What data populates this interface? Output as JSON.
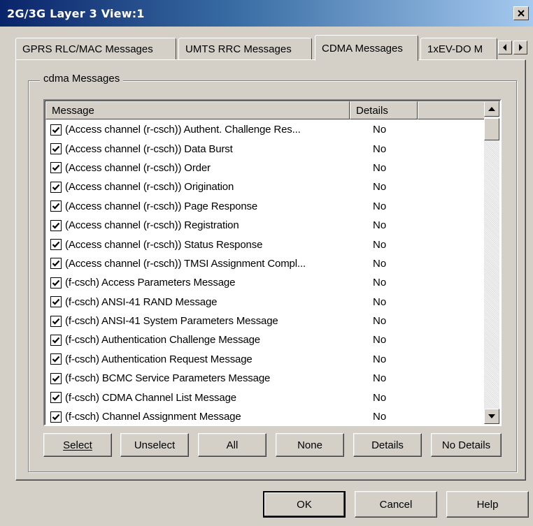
{
  "window": {
    "title": "2G/3G Layer 3 View:1"
  },
  "tabs": [
    {
      "label": "GPRS RLC/MAC Messages",
      "active": false
    },
    {
      "label": "UMTS RRC Messages",
      "active": false
    },
    {
      "label": "CDMA Messages",
      "active": true
    },
    {
      "label": "1xEV-DO M",
      "active": false
    }
  ],
  "group": {
    "title": "cdma Messages"
  },
  "list": {
    "columns": [
      "Message",
      "Details",
      ""
    ],
    "rows": [
      {
        "message": "(Access channel (r-csch)) Authent. Challenge Res...",
        "details": "No",
        "checked": true
      },
      {
        "message": "(Access channel (r-csch)) Data Burst",
        "details": "No",
        "checked": true
      },
      {
        "message": "(Access channel (r-csch)) Order",
        "details": "No",
        "checked": true
      },
      {
        "message": "(Access channel (r-csch)) Origination",
        "details": "No",
        "checked": true
      },
      {
        "message": "(Access channel (r-csch)) Page Response",
        "details": "No",
        "checked": true
      },
      {
        "message": "(Access channel (r-csch)) Registration",
        "details": "No",
        "checked": true
      },
      {
        "message": "(Access channel (r-csch)) Status Response",
        "details": "No",
        "checked": true
      },
      {
        "message": "(Access channel (r-csch)) TMSI Assignment Compl...",
        "details": "No",
        "checked": true
      },
      {
        "message": "(f-csch) Access Parameters Message",
        "details": "No",
        "checked": true
      },
      {
        "message": "(f-csch) ANSI-41 RAND Message",
        "details": "No",
        "checked": true
      },
      {
        "message": "(f-csch) ANSI-41 System Parameters Message",
        "details": "No",
        "checked": true
      },
      {
        "message": "(f-csch) Authentication Challenge Message",
        "details": "No",
        "checked": true
      },
      {
        "message": "(f-csch) Authentication Request Message",
        "details": "No",
        "checked": true
      },
      {
        "message": "(f-csch) BCMC Service Parameters Message",
        "details": "No",
        "checked": true
      },
      {
        "message": "(f-csch) CDMA Channel List Message",
        "details": "No",
        "checked": true
      },
      {
        "message": "(f-csch) Channel Assignment Message",
        "details": "No",
        "checked": true
      }
    ]
  },
  "actions": {
    "select": "Select",
    "unselect": "Unselect",
    "all": "All",
    "none": "None",
    "details": "Details",
    "no_details": "No Details"
  },
  "footer": {
    "ok": "OK",
    "cancel": "Cancel",
    "help": "Help"
  }
}
